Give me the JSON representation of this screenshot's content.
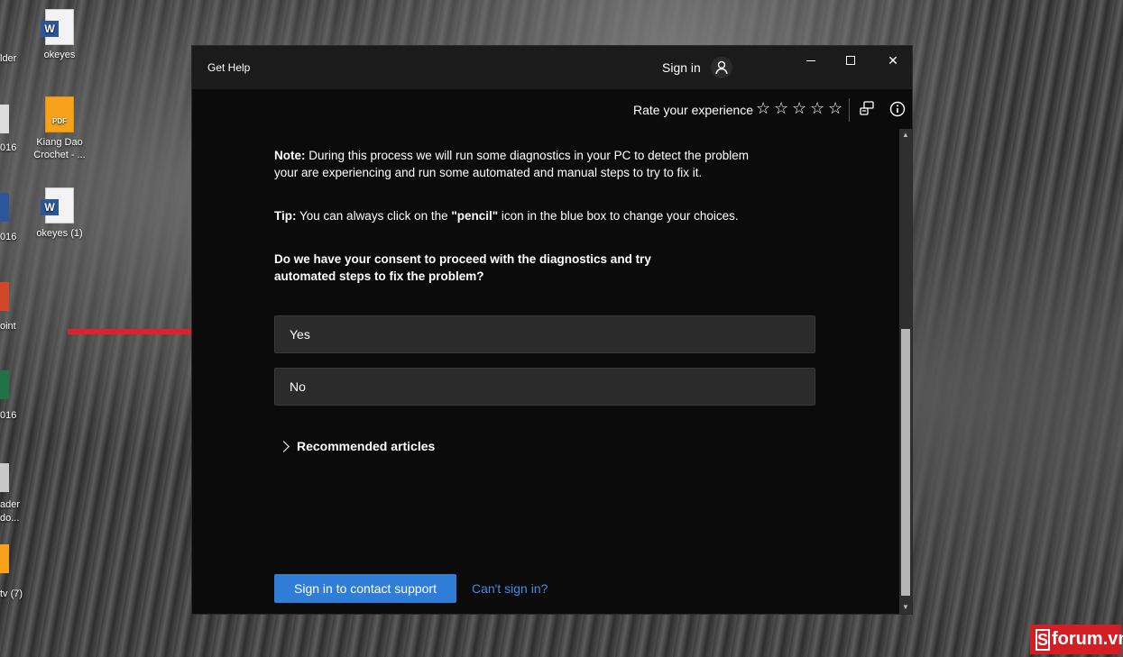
{
  "desktop": {
    "icons": [
      {
        "label": "okeyes",
        "type": "word"
      },
      {
        "label": "Kiang Dao Crochet - ...",
        "type": "pdf"
      },
      {
        "label": "okeyes (1)",
        "type": "word"
      }
    ],
    "edge_labels": [
      "lder",
      "016",
      "016",
      "oint",
      "016",
      "ader",
      "do...",
      "tv (7)"
    ]
  },
  "window": {
    "title": "Get Help",
    "sign_in": "Sign in",
    "controls": {
      "minimize": "minimize-icon",
      "maximize": "maximize-icon",
      "close": "✕"
    }
  },
  "rating": {
    "label": "Rate your experience",
    "stars": [
      "☆",
      "☆",
      "☆",
      "☆",
      "☆"
    ]
  },
  "content": {
    "note_label": "Note:",
    "note_text": " During this process we will run some diagnostics in your PC to detect the problem your are experiencing and run some automated  and manual steps to try to fix it.",
    "tip_label": "Tip:",
    "tip_text_1": " You can always click on the ",
    "tip_bold": "\"pencil\"",
    "tip_text_2": " icon in the blue box to change your choices.",
    "consent": "Do we have your consent to proceed with the diagnostics and try automated steps to fix the problem?",
    "choices": {
      "yes": "Yes",
      "no": "No"
    },
    "recommended": "Recommended articles"
  },
  "footer": {
    "cta": "Sign in to contact support",
    "cant_sign_in": "Can't sign in?"
  },
  "watermark": {
    "s": "S",
    "text": "forum.vn"
  },
  "colors": {
    "accent": "#2f7dd6",
    "link": "#3d8fe6",
    "arrow": "#e2202a",
    "window_bg": "#0b0b0b"
  }
}
